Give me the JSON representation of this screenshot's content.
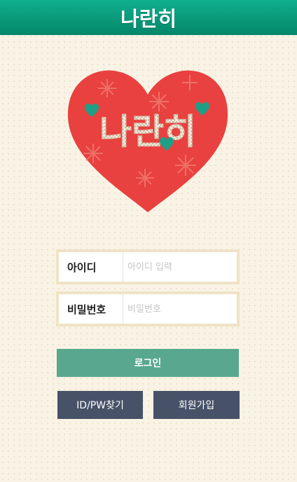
{
  "header": {
    "title": "나란히"
  },
  "logo": {
    "text": "나란히"
  },
  "login_form": {
    "id_label": "아이디",
    "id_placeholder": "아이디 입력",
    "pw_label": "비밀번호",
    "pw_placeholder": "비밀번호",
    "login_button": "로그인",
    "find_button": "ID/PW찾기",
    "join_button": "회원가입"
  },
  "colors": {
    "header": "#0a9b7c",
    "heart": "#e8413f",
    "login_button": "#59a78f",
    "secondary_button": "#475268",
    "background": "#f9f3e6"
  }
}
